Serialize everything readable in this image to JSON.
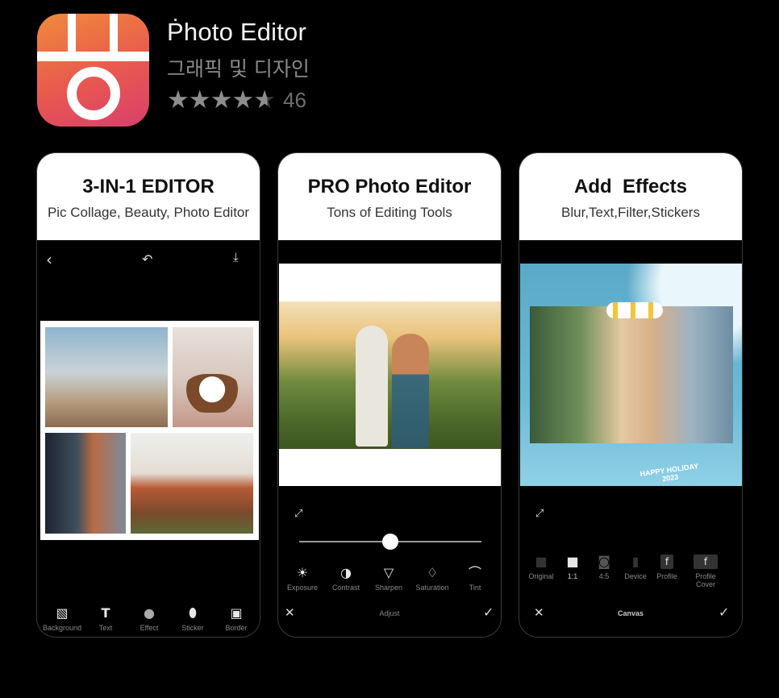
{
  "app": {
    "title": "Ṗhoto Editor",
    "category": "그래픽 및 디자인",
    "rating_count": "46",
    "rating_stars": 4.5
  },
  "cards": [
    {
      "heading": "3-IN-1 EDITOR",
      "subheading": "Pic Collage, Beauty, Photo Editor",
      "toolbar": [
        {
          "label": "Background",
          "icon": "background-icon",
          "glyph": "▧"
        },
        {
          "label": "Text",
          "icon": "text-icon",
          "glyph": "T"
        },
        {
          "label": "Effect",
          "icon": "effect-icon",
          "glyph": "●"
        },
        {
          "label": "Sticker",
          "icon": "sticker-icon",
          "glyph": "⬮"
        },
        {
          "label": "Border",
          "icon": "border-icon",
          "glyph": "▣"
        }
      ]
    },
    {
      "heading": "PRO Photo Editor",
      "subheading": "Tons of Editing Tools",
      "slider_value": 0.5,
      "tools": [
        {
          "label": "Exposure",
          "icon": "exposure-icon",
          "glyph": "☀"
        },
        {
          "label": "Contrast",
          "icon": "contrast-icon",
          "glyph": "◑"
        },
        {
          "label": "Sharpen",
          "icon": "sharpen-icon",
          "glyph": "▽"
        },
        {
          "label": "Saturation",
          "icon": "saturation-icon",
          "glyph": "♢"
        },
        {
          "label": "Tint",
          "icon": "tint-icon",
          "glyph": "⌒"
        }
      ],
      "bottom_label": "Adjust"
    },
    {
      "heading": "Add  Effects",
      "subheading": "Blur,Text,Filter,Stickers",
      "photo_text_line1": "HAPPY HOLIDAY",
      "photo_text_line2": "2023",
      "ratios": [
        {
          "label": "Original",
          "glyph": "■"
        },
        {
          "label": "1:1",
          "glyph": "■"
        },
        {
          "label": "4:5",
          "glyph": "◙"
        },
        {
          "label": "Device",
          "glyph": "▮"
        },
        {
          "label": "Profile",
          "glyph": "f"
        },
        {
          "label": "Profile Cover",
          "glyph": "f"
        }
      ],
      "bottom_label": "Canvas"
    }
  ]
}
